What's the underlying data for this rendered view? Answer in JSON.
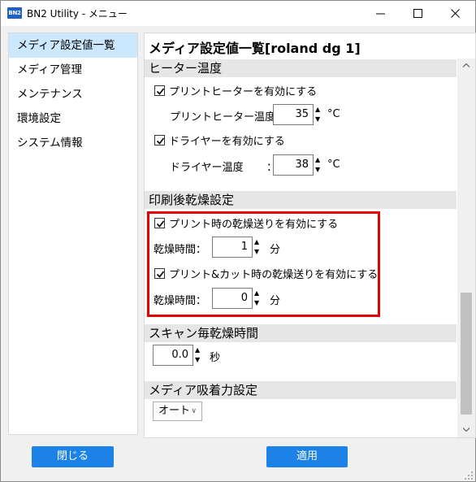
{
  "window": {
    "title": "BN2 Utility - メニュー",
    "icon_text": "BN2"
  },
  "sidebar": {
    "items": [
      {
        "label": "メディア設定値一覧",
        "selected": true
      },
      {
        "label": "メディア管理"
      },
      {
        "label": "メンテナンス"
      },
      {
        "label": "環境設定"
      },
      {
        "label": "システム情報"
      }
    ],
    "close_label": "閉じる"
  },
  "main": {
    "title": "メディア設定値一覧[roland dg 1]",
    "heater": {
      "header": "ヒーター温度",
      "print_heater_check": {
        "label": "プリントヒーターを有効にする",
        "checked": true
      },
      "print_heater_temp": {
        "label": "プリントヒーター温度：",
        "value": "35",
        "unit": "°C"
      },
      "dryer_check": {
        "label": "ドライヤーを有効にする",
        "checked": true
      },
      "dryer_temp": {
        "label": "ドライヤー温度",
        "colon": "：",
        "value": "38",
        "unit": "°C"
      }
    },
    "after_print_dry": {
      "header": "印刷後乾燥設定",
      "print_dry_feed_check": {
        "label": "プリント時の乾燥送りを有効にする",
        "checked": true
      },
      "print_dry_time": {
        "label": "乾燥時間：",
        "value": "1",
        "unit": "分"
      },
      "printcut_dry_feed_check": {
        "label": "プリント&カット時の乾燥送りを有効にする",
        "checked": true
      },
      "printcut_dry_time": {
        "label": "乾燥時間：",
        "value": "0",
        "unit": "分"
      }
    },
    "scan_dry": {
      "header": "スキャン毎乾燥時間",
      "value": "0.0",
      "unit": "秒"
    },
    "media_suction": {
      "header": "メディア吸着力設定",
      "selected": "オート"
    },
    "apply_label": "適用"
  },
  "colors": {
    "accent": "#1d82e8",
    "highlight": "#e60000",
    "selection": "#cce8ff"
  }
}
